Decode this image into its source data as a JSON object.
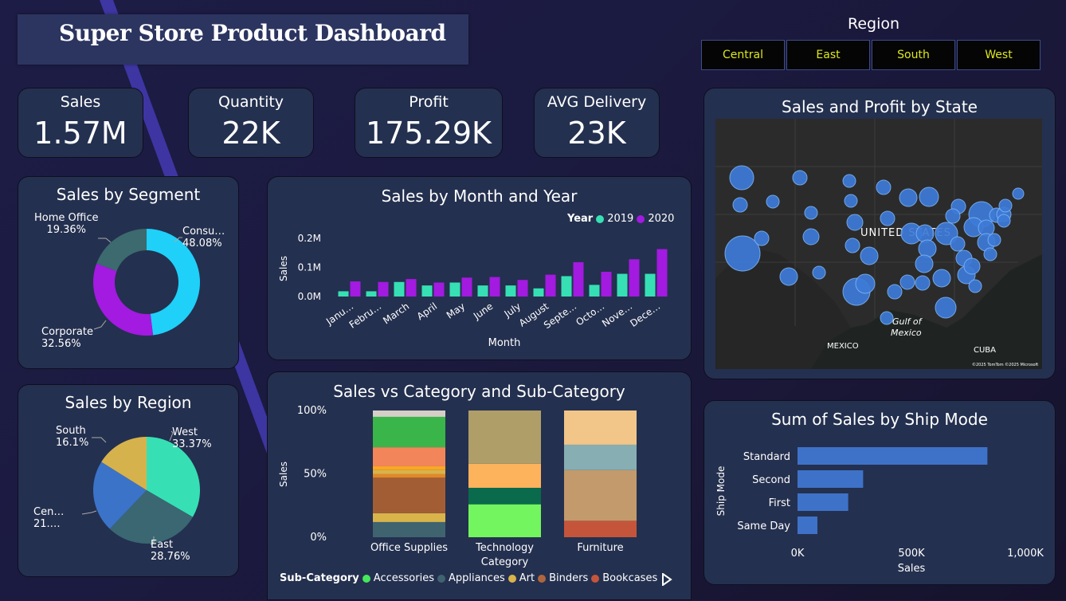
{
  "title": "Super Store Product Dashboard",
  "region_filter": {
    "label": "Region",
    "options": [
      "Central",
      "East",
      "South",
      "West"
    ]
  },
  "kpis": [
    {
      "label": "Sales",
      "value": "1.57M"
    },
    {
      "label": "Quantity",
      "value": "22K"
    },
    {
      "label": "Profit",
      "value": "175.29K"
    },
    {
      "label": "AVG Delivery",
      "value": "23K"
    }
  ],
  "segment": {
    "title": "Sales by Segment",
    "slices": [
      {
        "name": "Consu…",
        "pct": "48.08%",
        "value": 48.08,
        "color": "#1fd0f9"
      },
      {
        "name": "Corporate",
        "pct": "32.56%",
        "value": 32.56,
        "color": "#a31ae0"
      },
      {
        "name": "Home Office",
        "pct": "19.36%",
        "value": 19.36,
        "color": "#3c6a6e"
      }
    ]
  },
  "region_chart": {
    "title": "Sales by Region",
    "slices": [
      {
        "name": "West",
        "pct": "33.37%",
        "value": 33.37,
        "color": "#36e0b4"
      },
      {
        "name": "East",
        "pct": "28.76%",
        "value": 28.76,
        "color": "#3a6771"
      },
      {
        "name": "Cen…",
        "pct": "21.…",
        "value": 21.77,
        "color": "#3b73c8"
      },
      {
        "name": "South",
        "pct": "16.1%",
        "value": 16.1,
        "color": "#d6b24c"
      }
    ]
  },
  "month_chart": {
    "title": "Sales by Month and Year",
    "legend_title": "Year",
    "xlabel": "Month",
    "ylabel": "Sales",
    "y_ticks": [
      "0.2M",
      "0.1M",
      "0.0M"
    ]
  },
  "category_chart": {
    "title": "Sales vs Category and Sub-Category",
    "ylabel": "Sales",
    "y_ticks": [
      "100%",
      "50%",
      "0%"
    ],
    "categories": [
      "Office Supplies",
      "Technology",
      "Furniture"
    ],
    "category_axis_extra": "Category",
    "legend_title": "Sub-Category",
    "legend": [
      {
        "name": "Accessories",
        "color": "#45e85c"
      },
      {
        "name": "Appliances",
        "color": "#3f6470"
      },
      {
        "name": "Art",
        "color": "#d8b44b"
      },
      {
        "name": "Binders",
        "color": "#b0663d"
      },
      {
        "name": "Bookcases",
        "color": "#c4553b"
      }
    ]
  },
  "map": {
    "title": "Sales and Profit by State",
    "label_us": "UNITED STATES",
    "label_mexico": "MEXICO",
    "label_gulf": "Gulf of Mexico",
    "label_cuba": "CUBA",
    "attribution": "©2025 TomTom ©2025 Microsoft"
  },
  "ship_chart": {
    "title": "Sum of Sales by Ship Mode",
    "ylabel": "Ship Mode",
    "xlabel": "Sales",
    "x_ticks": [
      "0K",
      "500K",
      "1,000K"
    ]
  },
  "chart_data": [
    {
      "type": "bar",
      "title": "Sales by Month and Year",
      "xlabel": "Month",
      "ylabel": "Sales",
      "categories": [
        "Janu…",
        "Febru…",
        "March",
        "April",
        "May",
        "June",
        "July",
        "August",
        "Septe…",
        "Octo…",
        "Nove…",
        "Dece…"
      ],
      "ylim": [
        0,
        0.2
      ],
      "series": [
        {
          "name": "2019",
          "color": "#36e0b4",
          "values": [
            0.018,
            0.018,
            0.05,
            0.038,
            0.048,
            0.038,
            0.038,
            0.028,
            0.07,
            0.04,
            0.078,
            0.078
          ]
        },
        {
          "name": "2020",
          "color": "#a31ae0",
          "values": [
            0.052,
            0.05,
            0.06,
            0.048,
            0.065,
            0.067,
            0.057,
            0.075,
            0.118,
            0.085,
            0.128,
            0.163
          ]
        }
      ]
    },
    {
      "type": "bar",
      "title": "Sales vs Category and Sub-Category",
      "stacked": "percent",
      "ylabel": "Sales",
      "categories": [
        "Office Supplies",
        "Technology",
        "Furniture"
      ],
      "stacks": [
        [
          {
            "color": "#3f6470",
            "value": 12
          },
          {
            "color": "#d8b44b",
            "value": 7
          },
          {
            "color": "#a35d34",
            "value": 28
          },
          {
            "color": "#e0892a",
            "value": 3
          },
          {
            "color": "#d8b44b",
            "value": 3
          },
          {
            "color": "#f9a825",
            "value": 3
          },
          {
            "color": "#f2855a",
            "value": 15
          },
          {
            "color": "#3ab54a",
            "value": 24
          },
          {
            "color": "#d6cfc7",
            "value": 5
          }
        ],
        [
          {
            "color": "#72f55e",
            "value": 26
          },
          {
            "color": "#0a6a4c",
            "value": 13
          },
          {
            "color": "#fdb25c",
            "value": 19
          },
          {
            "color": "#b09e69",
            "value": 42
          }
        ],
        [
          {
            "color": "#c4553b",
            "value": 13
          },
          {
            "color": "#c39a6b",
            "value": 40
          },
          {
            "color": "#87aeb2",
            "value": 20
          },
          {
            "color": "#f2c588",
            "value": 27
          }
        ]
      ]
    },
    {
      "type": "bar",
      "orientation": "horizontal",
      "title": "Sum of Sales by Ship Mode",
      "xlabel": "Sales",
      "ylabel": "Ship Mode",
      "categories": [
        "Standard",
        "Second",
        "First",
        "Same Day"
      ],
      "values": [
        955,
        330,
        255,
        100
      ],
      "xlim": [
        0,
        1150
      ],
      "color": "#3e72c8"
    },
    {
      "type": "pie",
      "title": "Sales by Segment",
      "categories": [
        "Consu…",
        "Corporate",
        "Home Office"
      ],
      "values": [
        48.08,
        32.56,
        19.36
      ]
    },
    {
      "type": "pie",
      "title": "Sales by Region",
      "categories": [
        "West",
        "East",
        "Cen…",
        "South"
      ],
      "values": [
        33.37,
        28.76,
        21.77,
        16.1
      ]
    }
  ]
}
